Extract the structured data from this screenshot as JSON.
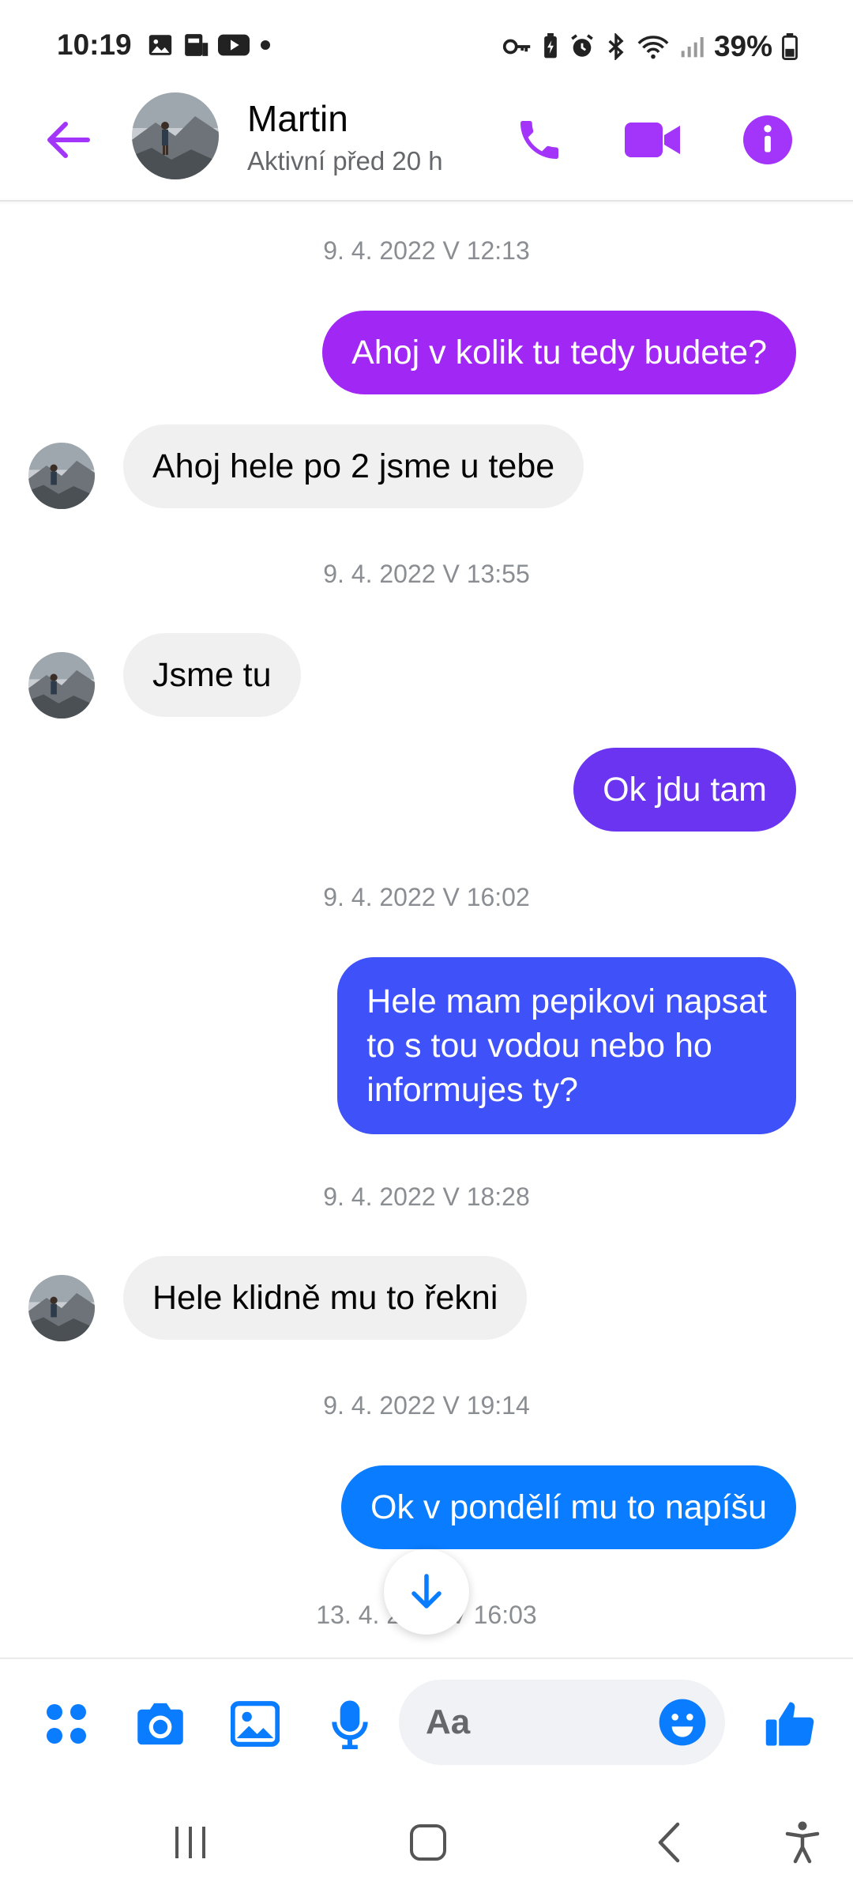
{
  "status_bar": {
    "time": "10:19",
    "battery_pct": "39%",
    "left_icons": [
      "gallery-icon",
      "sim-card-icon",
      "youtube-icon",
      "dot-icon"
    ],
    "right_icons": [
      "key-icon",
      "battery-saver-icon",
      "alarm-icon",
      "bluetooth-icon",
      "wifi-icon",
      "signal-icon",
      "battery-icon"
    ]
  },
  "header": {
    "contact_name": "Martin",
    "contact_status": "Aktivní před 20 h",
    "accent_color": "#a334fa"
  },
  "messages": [
    {
      "type": "timestamp",
      "text": "9. 4. 2022 V 12:13"
    },
    {
      "type": "out",
      "text": "Ahoj v kolik tu tedy budete?",
      "color": "#a027f4"
    },
    {
      "type": "in",
      "text": "Ahoj hele po 2 jsme u tebe"
    },
    {
      "type": "timestamp",
      "text": "9. 4. 2022 V 13:55"
    },
    {
      "type": "in",
      "text": "Jsme tu"
    },
    {
      "type": "out",
      "text": "Ok jdu tam",
      "color": "#6b34f1"
    },
    {
      "type": "timestamp",
      "text": "9. 4. 2022 V 16:02"
    },
    {
      "type": "out",
      "lines": [
        "Hele mam pepikovi napsat",
        "to s tou vodou nebo ho",
        "informujes ty?"
      ],
      "color": "#3f51f8"
    },
    {
      "type": "timestamp",
      "text": "9. 4. 2022 V 18:28"
    },
    {
      "type": "in",
      "text": "Hele klidně mu to řekni"
    },
    {
      "type": "timestamp",
      "text": "9. 4. 2022 V 19:14"
    },
    {
      "type": "out",
      "text": "Ok v pondělí mu to napíšu",
      "color": "#0a7cff"
    },
    {
      "type": "timestamp",
      "text": "13. 4. 2022 V 16:03"
    }
  ],
  "composer": {
    "placeholder": "Aa",
    "accent_color": "#0a7cff",
    "icons": [
      "apps-icon",
      "camera-icon",
      "gallery-icon",
      "microphone-icon",
      "emoji-icon",
      "thumbs-up-icon"
    ]
  },
  "nav": {
    "buttons": [
      "recents-button",
      "home-button",
      "back-button",
      "accessibility-button"
    ]
  }
}
